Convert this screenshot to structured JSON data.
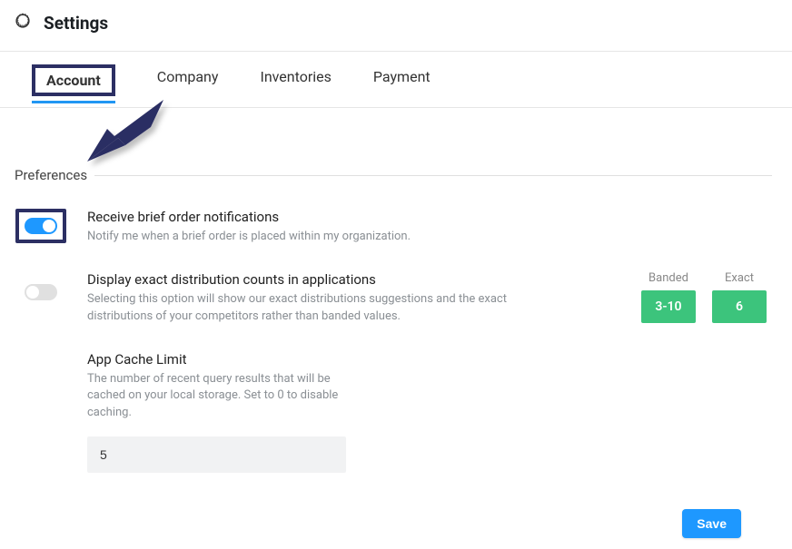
{
  "header": {
    "title": "Settings"
  },
  "tabs": {
    "items": [
      "Account",
      "Company",
      "Inventories",
      "Payment"
    ],
    "active": "Account"
  },
  "section": {
    "title": "Preferences"
  },
  "prefs": {
    "notify": {
      "title": "Receive brief order notifications",
      "desc": "Notify me when a brief order is placed within my organization.",
      "on": true
    },
    "distribution": {
      "title": "Display exact distribution counts in applications",
      "desc": "Selecting this option will show our exact distributions suggestions and the exact distributions of your competitors rather than banded values.",
      "on": false,
      "banded_label": "Banded",
      "banded_value": "3-10",
      "exact_label": "Exact",
      "exact_value": "6"
    },
    "cache": {
      "title": "App Cache Limit",
      "desc": "The number of recent query results that will be cached on your local storage. Set to 0 to disable caching.",
      "value": "5"
    }
  },
  "actions": {
    "save": "Save"
  }
}
